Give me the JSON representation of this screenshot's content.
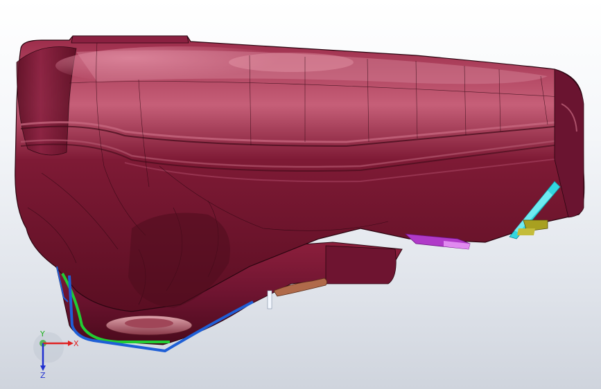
{
  "view": {
    "background_top": "#ffffff",
    "background_bottom": "#cfd4dd"
  },
  "model": {
    "body_color": "#7a1530",
    "highlight_color": "#c4607a",
    "shadow_color": "#3e0a18",
    "edge_color": "#2a0510",
    "pipe_color": "#1f5fd6",
    "hose_green": "#22cc33",
    "pad_cyan": "#33d6e0",
    "pad_magenta": "#b03ac8",
    "pad_olive": "#a8a020",
    "connector_copper": "#b06a4a",
    "flange_color": "#c98890"
  },
  "triad": {
    "x_label": "X",
    "y_label": "Y",
    "z_label": "Z",
    "x_color": "#e02020",
    "y_color": "#20b020",
    "z_color": "#2030d0"
  }
}
